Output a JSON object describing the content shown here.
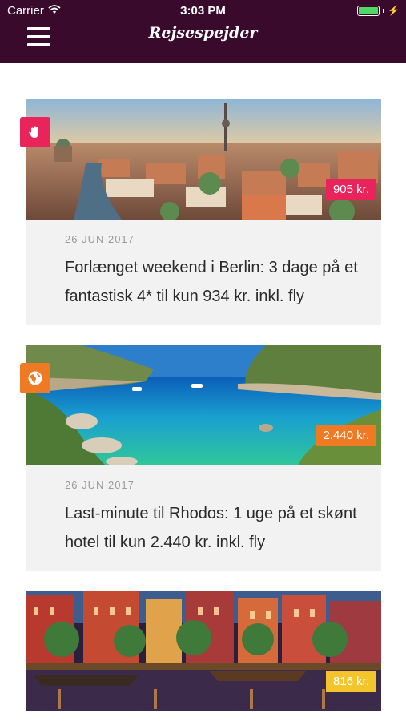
{
  "status_bar": {
    "carrier": "Carrier",
    "time": "3:03 PM"
  },
  "header": {
    "title": "Rejsespejder"
  },
  "colors": {
    "header_bg": "#3a0a2d",
    "card_bg": "#f2f2f2",
    "pink": "#e8245a",
    "orange": "#f07a23",
    "yellow": "#f3c42c"
  },
  "deals": [
    {
      "price": "905 kr.",
      "date": "26 JUN 2017",
      "title": "Forlænget weekend i Berlin: 3 dage på et fantastisk 4* til kun 934 kr. inkl. fly",
      "badge_icon": "hand-icon",
      "accent": "#e8245a"
    },
    {
      "price": "2.440 kr.",
      "date": "26 JUN 2017",
      "title": "Last-minute til Rhodos: 1 uge på et skønt hotel til kun 2.440 kr. inkl. fly",
      "badge_icon": "globe-icon",
      "accent": "#f07a23"
    },
    {
      "price": "816 kr.",
      "accent": "#f3c42c"
    }
  ]
}
